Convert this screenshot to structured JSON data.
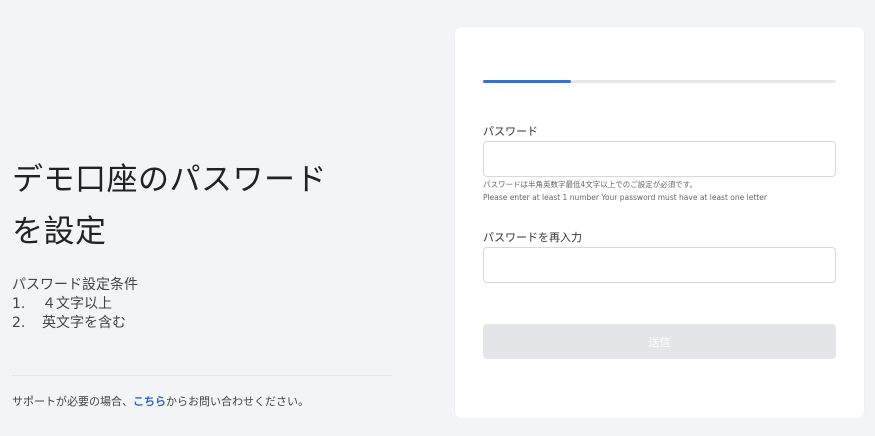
{
  "left": {
    "heading_line1": "デモ口座のパスワード",
    "heading_line2": "を設定",
    "conditions_title": "パスワード設定条件",
    "conditions": [
      {
        "num": "1.",
        "text": "４文字以上"
      },
      {
        "num": "2.",
        "text": "英文字を含む"
      }
    ],
    "support_prefix": "サポートが必要の場合、",
    "support_link": "こちら",
    "support_suffix": "からお問い合わせください。"
  },
  "form": {
    "progress_fraction": 0.25,
    "password_label": "パスワード",
    "password_value": "",
    "password_hint_ja": "パスワードは半角英数字最低4文字以上でのご設定が必須です。",
    "password_hint_en": "Please enter at least 1 number Your password must have at least one letter",
    "confirm_label": "パスワードを再入力",
    "confirm_value": "",
    "submit_label": "送信"
  },
  "colors": {
    "accent": "#3d6fc9",
    "link": "#2e63c9",
    "background": "#f3f4f6",
    "button_disabled": "#e4e5e8"
  }
}
